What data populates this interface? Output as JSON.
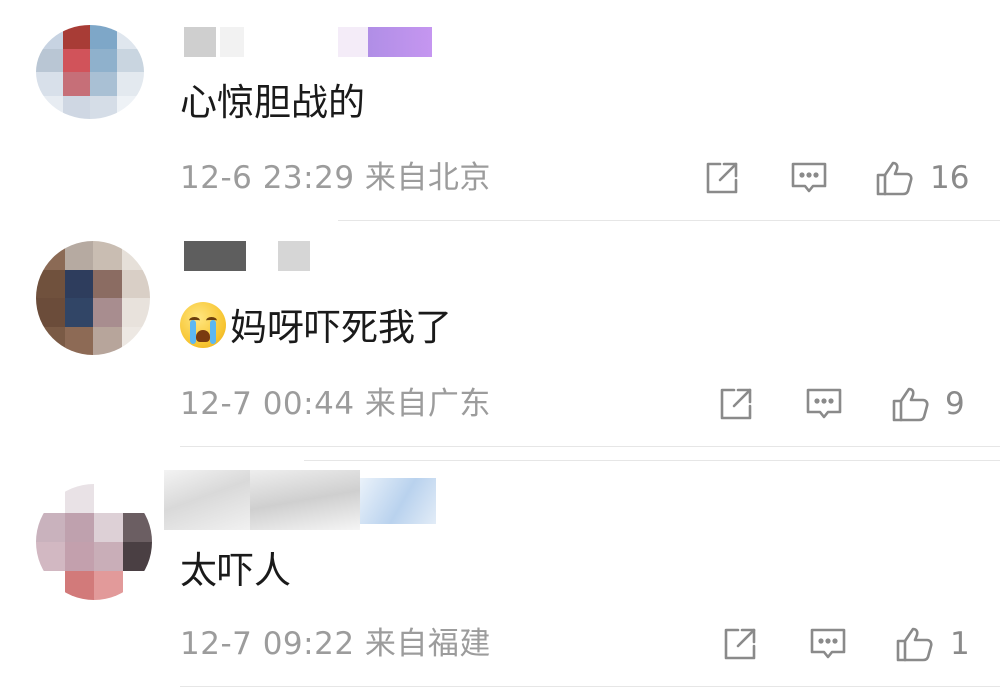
{
  "comments": [
    {
      "text": "心惊胆战的",
      "time": "12-6 23:29",
      "location": "来自北京",
      "likes": "16",
      "has_emoji": false
    },
    {
      "text": "妈呀吓死我了",
      "time": "12-7 00:44",
      "location": "来自广东",
      "likes": "9",
      "has_emoji": true,
      "emoji_name": "crying-face-emoji"
    },
    {
      "text": "太吓人",
      "time": "12-7 09:22",
      "location": "来自福建",
      "likes": "1",
      "has_emoji": false
    }
  ],
  "icons": {
    "share": "share-icon",
    "reply": "comment-icon",
    "like": "thumbs-up-icon"
  },
  "colors": {
    "text": "#1a1a1a",
    "meta": "#9c9c9c",
    "icon": "#8a8a8a",
    "divider": "#e6e6e6"
  }
}
